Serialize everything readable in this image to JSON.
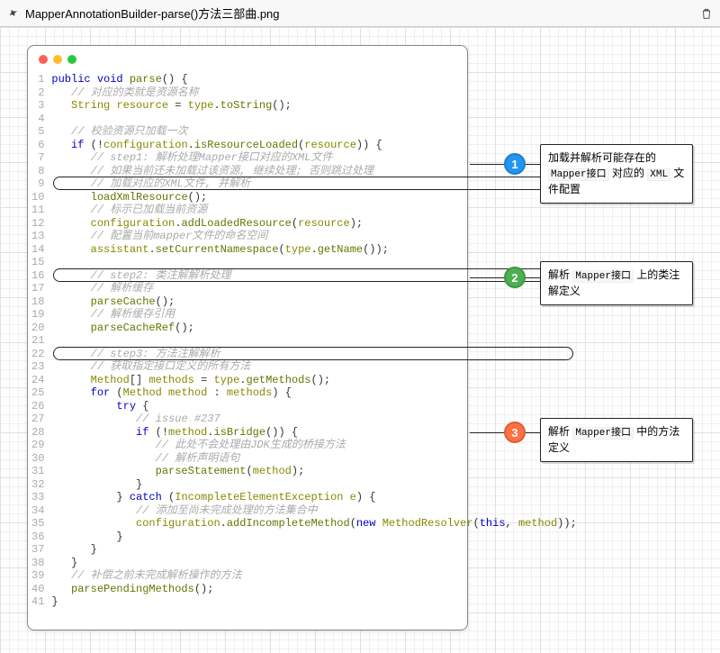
{
  "toolbar": {
    "title": "MapperAnnotationBuilder-parse()方法三部曲.png"
  },
  "code": {
    "lines_count": 41,
    "l1_kw": "public void",
    "l1_name": " parse",
    "l1_rest": "() {",
    "l2_cmt": "// 对应的类就是资源名称",
    "l3_cls": "String",
    "l3_var": " resource",
    "l3_eq": " = ",
    "l3_var2": "type",
    "l3_dot": ".",
    "l3_m": "toString",
    "l3_end": "();",
    "l5_cmt": "// 校验资源只加载一次",
    "l6_if": "if",
    "l6_par": " (!",
    "l6_cfg": "configuration",
    "l6_dot": ".",
    "l6_m": "isResourceLoaded",
    "l6_mid": "(",
    "l6_arg": "resource",
    "l6_end": ")) {",
    "l7_cmt": "// step1: 解析处理Mapper接口对应的XML文件",
    "l8_cmt": "// 如果当前还未加载过该资源, 继续处理; 否则跳过处理",
    "l9_cmt": "// 加载对应的XML文件, 并解析",
    "l10_m": "loadXmlResource",
    "l10_end": "();",
    "l11_cmt": "// 标示已加载当前资源",
    "l12_cfg": "configuration",
    "l12_m": "addLoadedResource",
    "l12_arg": "resource",
    "l12_end": ");",
    "l12_open": "(",
    "l13_cmt": "// 配置当前mapper文件的命名空间",
    "l14_a": "assistant",
    "l14_m": "setCurrentNamespace",
    "l14_open": "(",
    "l14_t": "type",
    "l14_m2": "getName",
    "l14_end": "());",
    "l16_cmt": "// step2: 类注解解析处理",
    "l17_cmt": "// 解析缓存",
    "l18_m": "parseCache",
    "l18_end": "();",
    "l19_cmt": "// 解析缓存引用",
    "l20_m": "parseCacheRef",
    "l20_end": "();",
    "l22_cmt": "// step3: 方法注解解析",
    "l23_cmt": "// 获取指定接口定义的所有方法",
    "l24_cls": "Method",
    "l24_arr": "[] ",
    "l24_var": "methods",
    "l24_eq": " = ",
    "l24_t": "type",
    "l24_m": "getMethods",
    "l24_end": "();",
    "l25_for": "for",
    "l25_open": " (",
    "l25_cls": "Method",
    "l25_var": " method",
    "l25_colon": " : ",
    "l25_arr": "methods",
    "l25_end": ") {",
    "l26_try": "try",
    "l26_end": " {",
    "l27_cmt": "// issue #237",
    "l28_if": "if",
    "l28_cond": " (!",
    "l28_var": "method",
    "l28_dot": ".",
    "l28_m": "isBridge",
    "l28_end": "()) {",
    "l29_cmt": "// 此处不会处理由JDK生成的桥接方法",
    "l30_cmt": "// 解析声明语句",
    "l31_m": "parseStatement",
    "l31_open": "(",
    "l31_arg": "method",
    "l31_end": ");",
    "l32_end": "}",
    "l33_catch": "} catch (",
    "l33_cls": "IncompleteElementException",
    "l33_var": " e",
    "l33_end": ") {",
    "l34_cmt": "// 添加至尚未完成处理的方法集合中",
    "l35_cfg": "configuration",
    "l35_m": "addIncompleteMethod",
    "l35_open": "(",
    "l35_new": "new ",
    "l35_cls": "MethodResolver",
    "l35_open2": "(",
    "l35_this": "this",
    "l35_comma": ", ",
    "l35_arg": "method",
    "l35_end": "));",
    "l36_end": "}",
    "l37_end": "}",
    "l38_end": "}",
    "l39_cmt": "// 补偿之前未完成解析操作的方法",
    "l40_m": "parsePendingMethods",
    "l40_end": "();",
    "l41_end": "}"
  },
  "bullets": {
    "b1": "1",
    "b2": "2",
    "b3": "3"
  },
  "callouts": {
    "c1_a": "加载并解析可能存在的 ",
    "c1_mono": "Mapper接口",
    "c1_b": " 对应的 ",
    "c1_mono2": "XML",
    "c1_c": " 文件配置",
    "c2_a": "解析 ",
    "c2_mono": "Mapper接口",
    "c2_b": " 上的类注解定义",
    "c3_a": "解析 ",
    "c3_mono": "Mapper接口",
    "c3_b": " 中的方法定义"
  }
}
